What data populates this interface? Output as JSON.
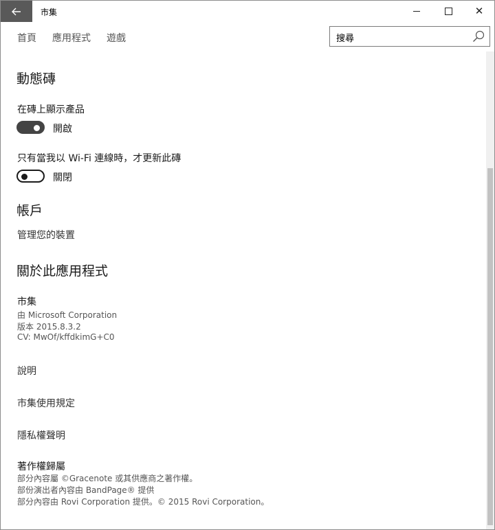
{
  "window": {
    "title": "市集"
  },
  "nav": {
    "items": [
      "首頁",
      "應用程式",
      "遊戲"
    ]
  },
  "search": {
    "value": "搜尋"
  },
  "tiles": {
    "heading": "動態磚",
    "show_products": {
      "label": "在磚上顯示產品",
      "state": "開啟",
      "on": true
    },
    "wifi_only": {
      "label": "只有當我以 Wi-Fi 連線時，才更新此磚",
      "state": "關閉",
      "on": false
    }
  },
  "account": {
    "heading": "帳戶",
    "manage_devices": "管理您的裝置"
  },
  "about": {
    "heading": "關於此應用程式",
    "app_name": "市集",
    "publisher": "由 Microsoft Corporation",
    "version": "版本 2015.8.3.2",
    "cv": "CV: MwOf/kffdkimG+C0",
    "links": [
      "說明",
      "市集使用規定",
      "隱私權聲明"
    ]
  },
  "copyright": {
    "heading": "著作權歸屬",
    "lines": [
      "部分內容屬 ©Gracenote 或其供應商之著作權。",
      "部份演出者內容由 BandPage® 提供",
      "部分內容由 Rovi Corporation 提供。©  2015 Rovi Corporation。"
    ]
  },
  "icons": {
    "back": "back-arrow-icon",
    "minimize": "minimize-icon",
    "maximize": "maximize-icon",
    "close": "close-icon",
    "search": "search-icon"
  },
  "colors": {
    "back_button": "#595959",
    "toggle_on": "#444444"
  }
}
